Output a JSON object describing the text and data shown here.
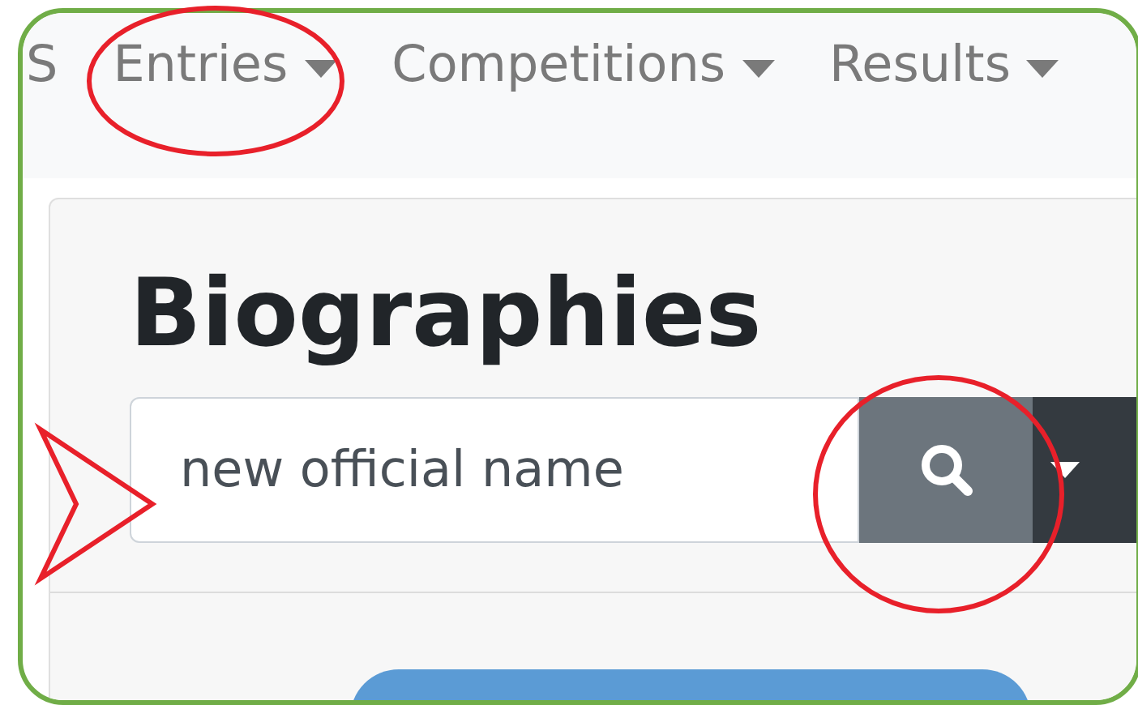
{
  "nav": {
    "items": [
      {
        "label": "S",
        "dropdown": false
      },
      {
        "label": "Entries",
        "dropdown": true
      },
      {
        "label": "Competitions",
        "dropdown": true
      },
      {
        "label": "Results",
        "dropdown": true
      }
    ]
  },
  "page": {
    "heading": "Biographies",
    "search": {
      "value": "new official name"
    }
  }
}
